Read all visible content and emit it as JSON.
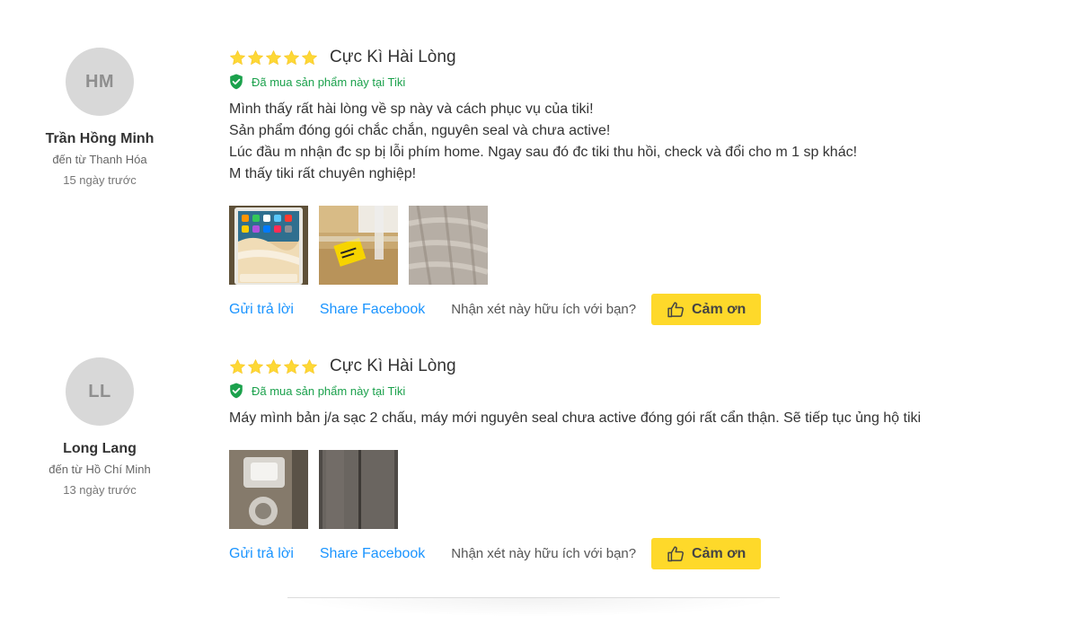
{
  "reviews": [
    {
      "author": {
        "initials": "HM",
        "name": "Trần Hồng Minh",
        "from": "đến từ Thanh Hóa",
        "date": "15 ngày trước"
      },
      "rating": 5,
      "headline": "Cực Kì Hài Lòng",
      "verified_text": "Đã mua sản phẩm này tại Tiki",
      "body": [
        "Mình thấy rất hài lòng về sp này và cách phục vụ của tiki!",
        "Sản phẩm đóng gói chắc chắn, nguyên seal và chưa active!",
        "Lúc đầu m nhận đc sp bị lỗi phím home. Ngay sau đó đc tiki thu hồi, check và đổi cho m 1 sp khác!",
        "M thấy tiki rất chuyên nghiệp!"
      ],
      "photos": [
        "tablet-home-screen-photo",
        "package-label-photo",
        "box-wrap-photo"
      ],
      "actions": {
        "reply": "Gửi trả lời",
        "share": "Share Facebook",
        "helpful": "Nhận xét này hữu ích với bạn?",
        "thanks": "Cảm ơn"
      }
    },
    {
      "author": {
        "initials": "LL",
        "name": "Long Lang",
        "from": "đến từ Hồ Chí Minh",
        "date": "13 ngày trước"
      },
      "rating": 5,
      "headline": "Cực Kì Hài Lòng",
      "verified_text": "Đã mua sản phẩm này tại Tiki",
      "body": [
        "Máy mình bản j/a sạc 2 chấu, máy mới nguyên seal chưa active đóng gói rất cẩn thận. Sẽ tiếp tục ủng hộ tiki"
      ],
      "photos": [
        "charger-photo",
        "tablet-back-photo"
      ],
      "actions": {
        "reply": "Gửi trả lời",
        "share": "Share Facebook",
        "helpful": "Nhận xét này hữu ích với bạn?",
        "thanks": "Cảm ơn"
      }
    }
  ],
  "colors": {
    "star": "#fdd836",
    "verified": "#1ba14c",
    "link": "#1a94ff",
    "button": "#fed92a",
    "avatar": "#d8d8d8"
  }
}
